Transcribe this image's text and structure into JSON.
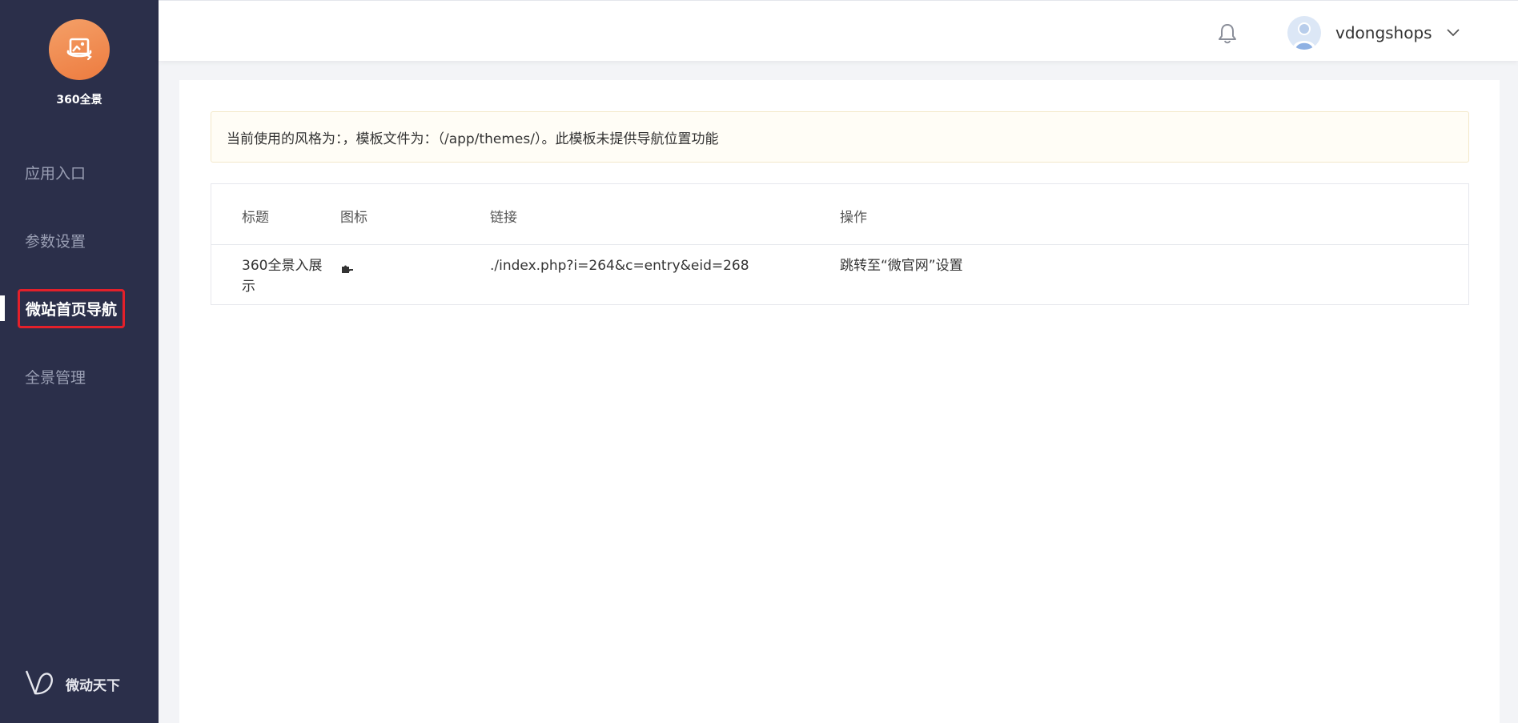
{
  "sidebar": {
    "app_name": "360全景",
    "items": [
      {
        "label": "应用入口"
      },
      {
        "label": "参数设置"
      },
      {
        "label": "微站首页导航"
      },
      {
        "label": "全景管理"
      }
    ],
    "brand": "微动天下"
  },
  "header": {
    "username": "vdongshops"
  },
  "notice": {
    "text": "当前使用的风格为：，模板文件为：（/app/themes/）。此模板未提供导航位置功能"
  },
  "table": {
    "columns": [
      "标题",
      "图标",
      "链接",
      "操作"
    ],
    "rows": [
      {
        "title": "360全景入展示",
        "icon": "puzzle-icon",
        "link": "./index.php?i=264&c=entry&eid=268",
        "action": "跳转至“微官网”设置"
      }
    ]
  },
  "colors": {
    "sidebar_bg": "#2b2f4a",
    "accent": "#ed7b3f",
    "highlight": "#e3202a"
  }
}
